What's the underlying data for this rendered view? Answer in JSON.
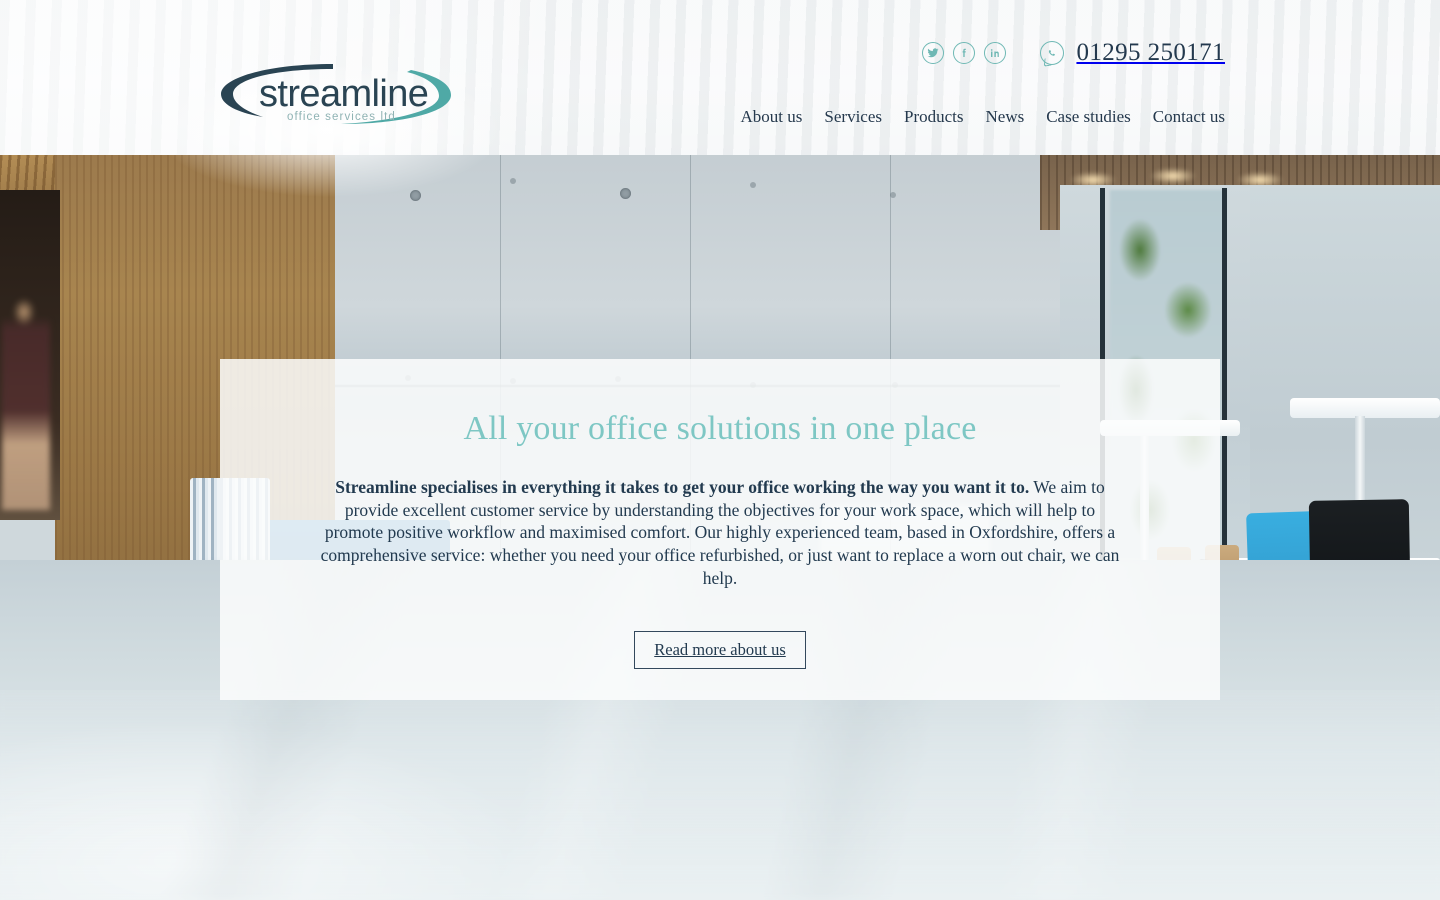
{
  "site": {
    "logo": {
      "name": "streamline",
      "tagline": "office services ltd"
    },
    "brand_colors": {
      "teal": "#7ec7c4",
      "logo_dark": "#2a4453",
      "logo_teal": "#4fa9a6",
      "navy_text": "#223a4f",
      "social_outline": "#6fb8b4"
    }
  },
  "header": {
    "social": [
      {
        "name": "twitter-icon",
        "label": "Twitter"
      },
      {
        "name": "facebook-icon",
        "label": "Facebook"
      },
      {
        "name": "linkedin-icon",
        "label": "LinkedIn"
      }
    ],
    "whatsapp_icon": "whatsapp-icon",
    "phone": "01295 250171",
    "nav": [
      {
        "label": "About us"
      },
      {
        "label": "Services"
      },
      {
        "label": "Products"
      },
      {
        "label": "News"
      },
      {
        "label": "Case studies"
      },
      {
        "label": "Contact us"
      }
    ]
  },
  "hero": {
    "headline": "All your office solutions in one place",
    "body_bold": "Streamline specialises in everything it takes to get your office working the way you want it to.",
    "body_rest": " We aim to provide excellent customer service by understanding the objectives for your work space, which will help to promote positive workflow and maximised comfort. Our highly experienced team, based in Oxfordshire, offers a comprehensive service: whether you need your office refurbished, or just want to replace a worn out chair, we can help.",
    "cta_label": "Read more about us"
  }
}
